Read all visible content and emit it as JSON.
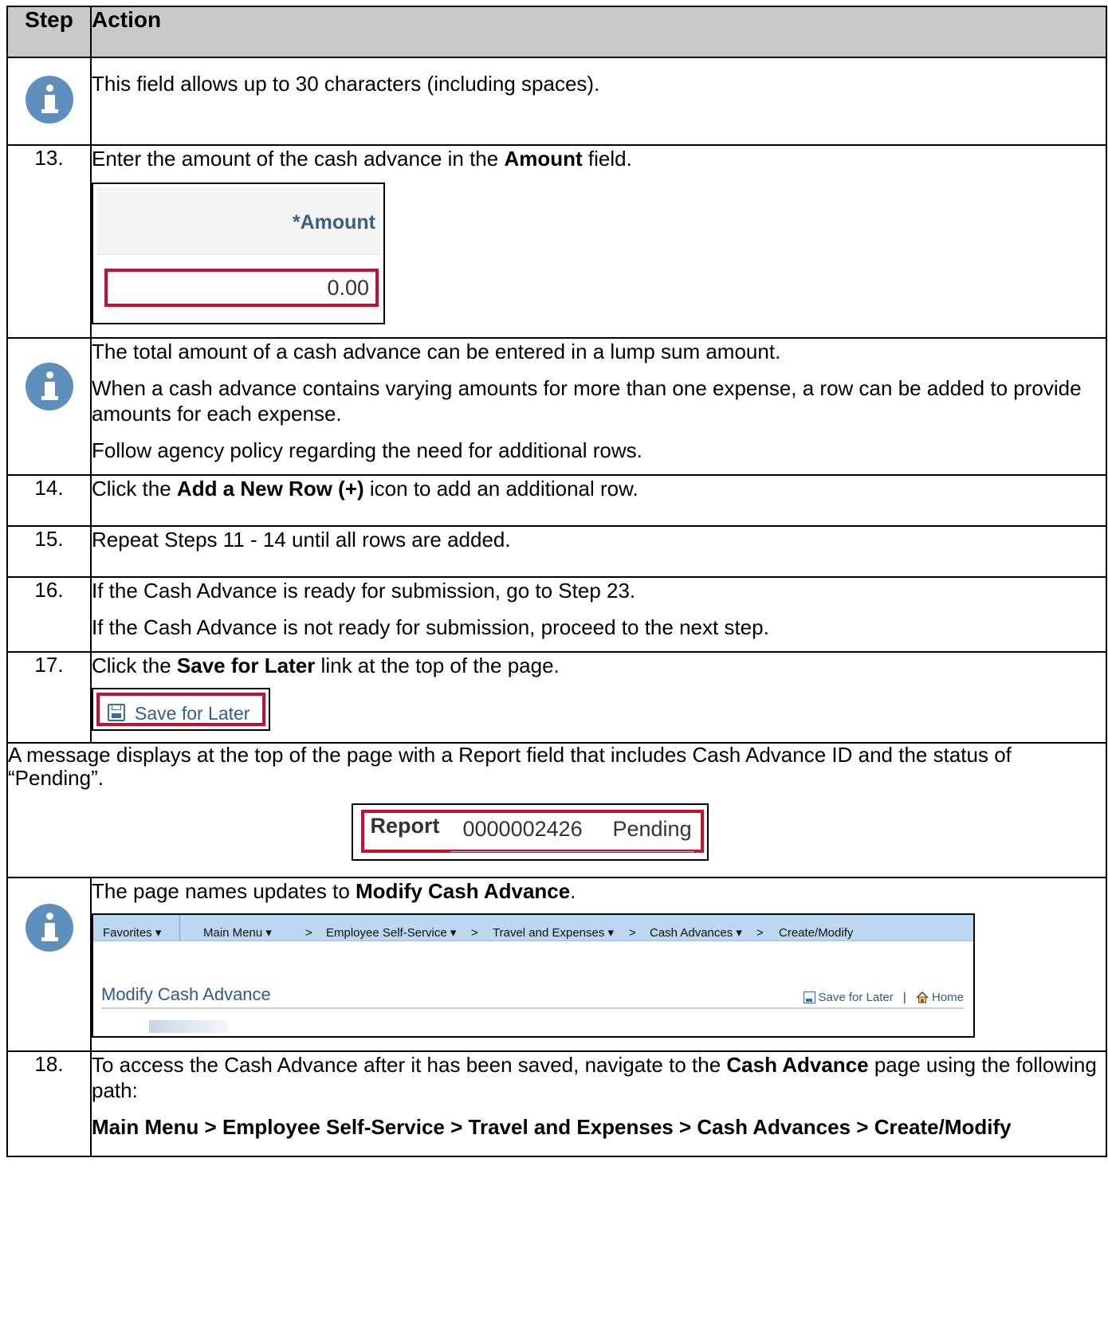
{
  "header": {
    "step": "Step",
    "action": "Action"
  },
  "rows": {
    "r1": {
      "text": "This field allows up to 30 characters (including spaces)."
    },
    "r2": {
      "num": "13.",
      "pre": "Enter the amount of the cash advance in the ",
      "bold": "Amount",
      "post": " field.",
      "shot": {
        "label": "*Amount",
        "value": "0.00"
      }
    },
    "r3": {
      "p1": "The total amount of a cash advance can be entered in a lump sum amount.",
      "p2": "When a cash advance contains varying amounts for more than one expense, a row can be added to provide amounts for each expense.",
      "p3": "Follow agency policy regarding the need for additional rows."
    },
    "r4": {
      "num": "14.",
      "pre": "Click the ",
      "bold": "Add a New Row (+)",
      "post": " icon to add an additional row."
    },
    "r5": {
      "num": "15.",
      "text": "Repeat Steps 11 - 14 until all rows are added."
    },
    "r6": {
      "num": "16.",
      "p1": "If the Cash Advance is ready for submission, go to Step 23.",
      "p2": "If the Cash Advance is not ready for submission, proceed to the next step."
    },
    "r7": {
      "num": "17.",
      "pre": "Click the ",
      "bold": "Save for Later",
      "post": " link at the top of the page.",
      "shot_label": "Save for Later"
    },
    "msg": {
      "text": "A message displays at the top of the page with a Report field that includes Cash Advance ID and the status of “Pending”.",
      "report_label": "Report",
      "report_id": "0000002426",
      "report_status": "Pending"
    },
    "r8": {
      "pre": "The page names updates to ",
      "bold": "Modify Cash Advance",
      "post": ".",
      "shot": {
        "nav": [
          "Favorites ▾",
          "Main Menu ▾",
          ">",
          "Employee Self-Service ▾",
          ">",
          "Travel and Expenses ▾",
          ">",
          "Cash Advances ▾",
          ">",
          "Create/Modify"
        ],
        "title": "Modify Cash Advance",
        "save": "Save for Later",
        "sep": "|",
        "home": "Home"
      }
    },
    "r9": {
      "num": "18.",
      "pre": "To access the Cash Advance after it has been saved, navigate to the ",
      "bold": "Cash Advance",
      "post": " page using the following path:",
      "path": "Main Menu > Employee Self-Service > Travel and Expenses > Cash Advances > Create/Modify"
    }
  },
  "colors": {
    "header_bg": "#c9c9c9",
    "info_icon": "#5f8fbd",
    "highlight": "#c8102e",
    "link": "#2d5b8c"
  }
}
